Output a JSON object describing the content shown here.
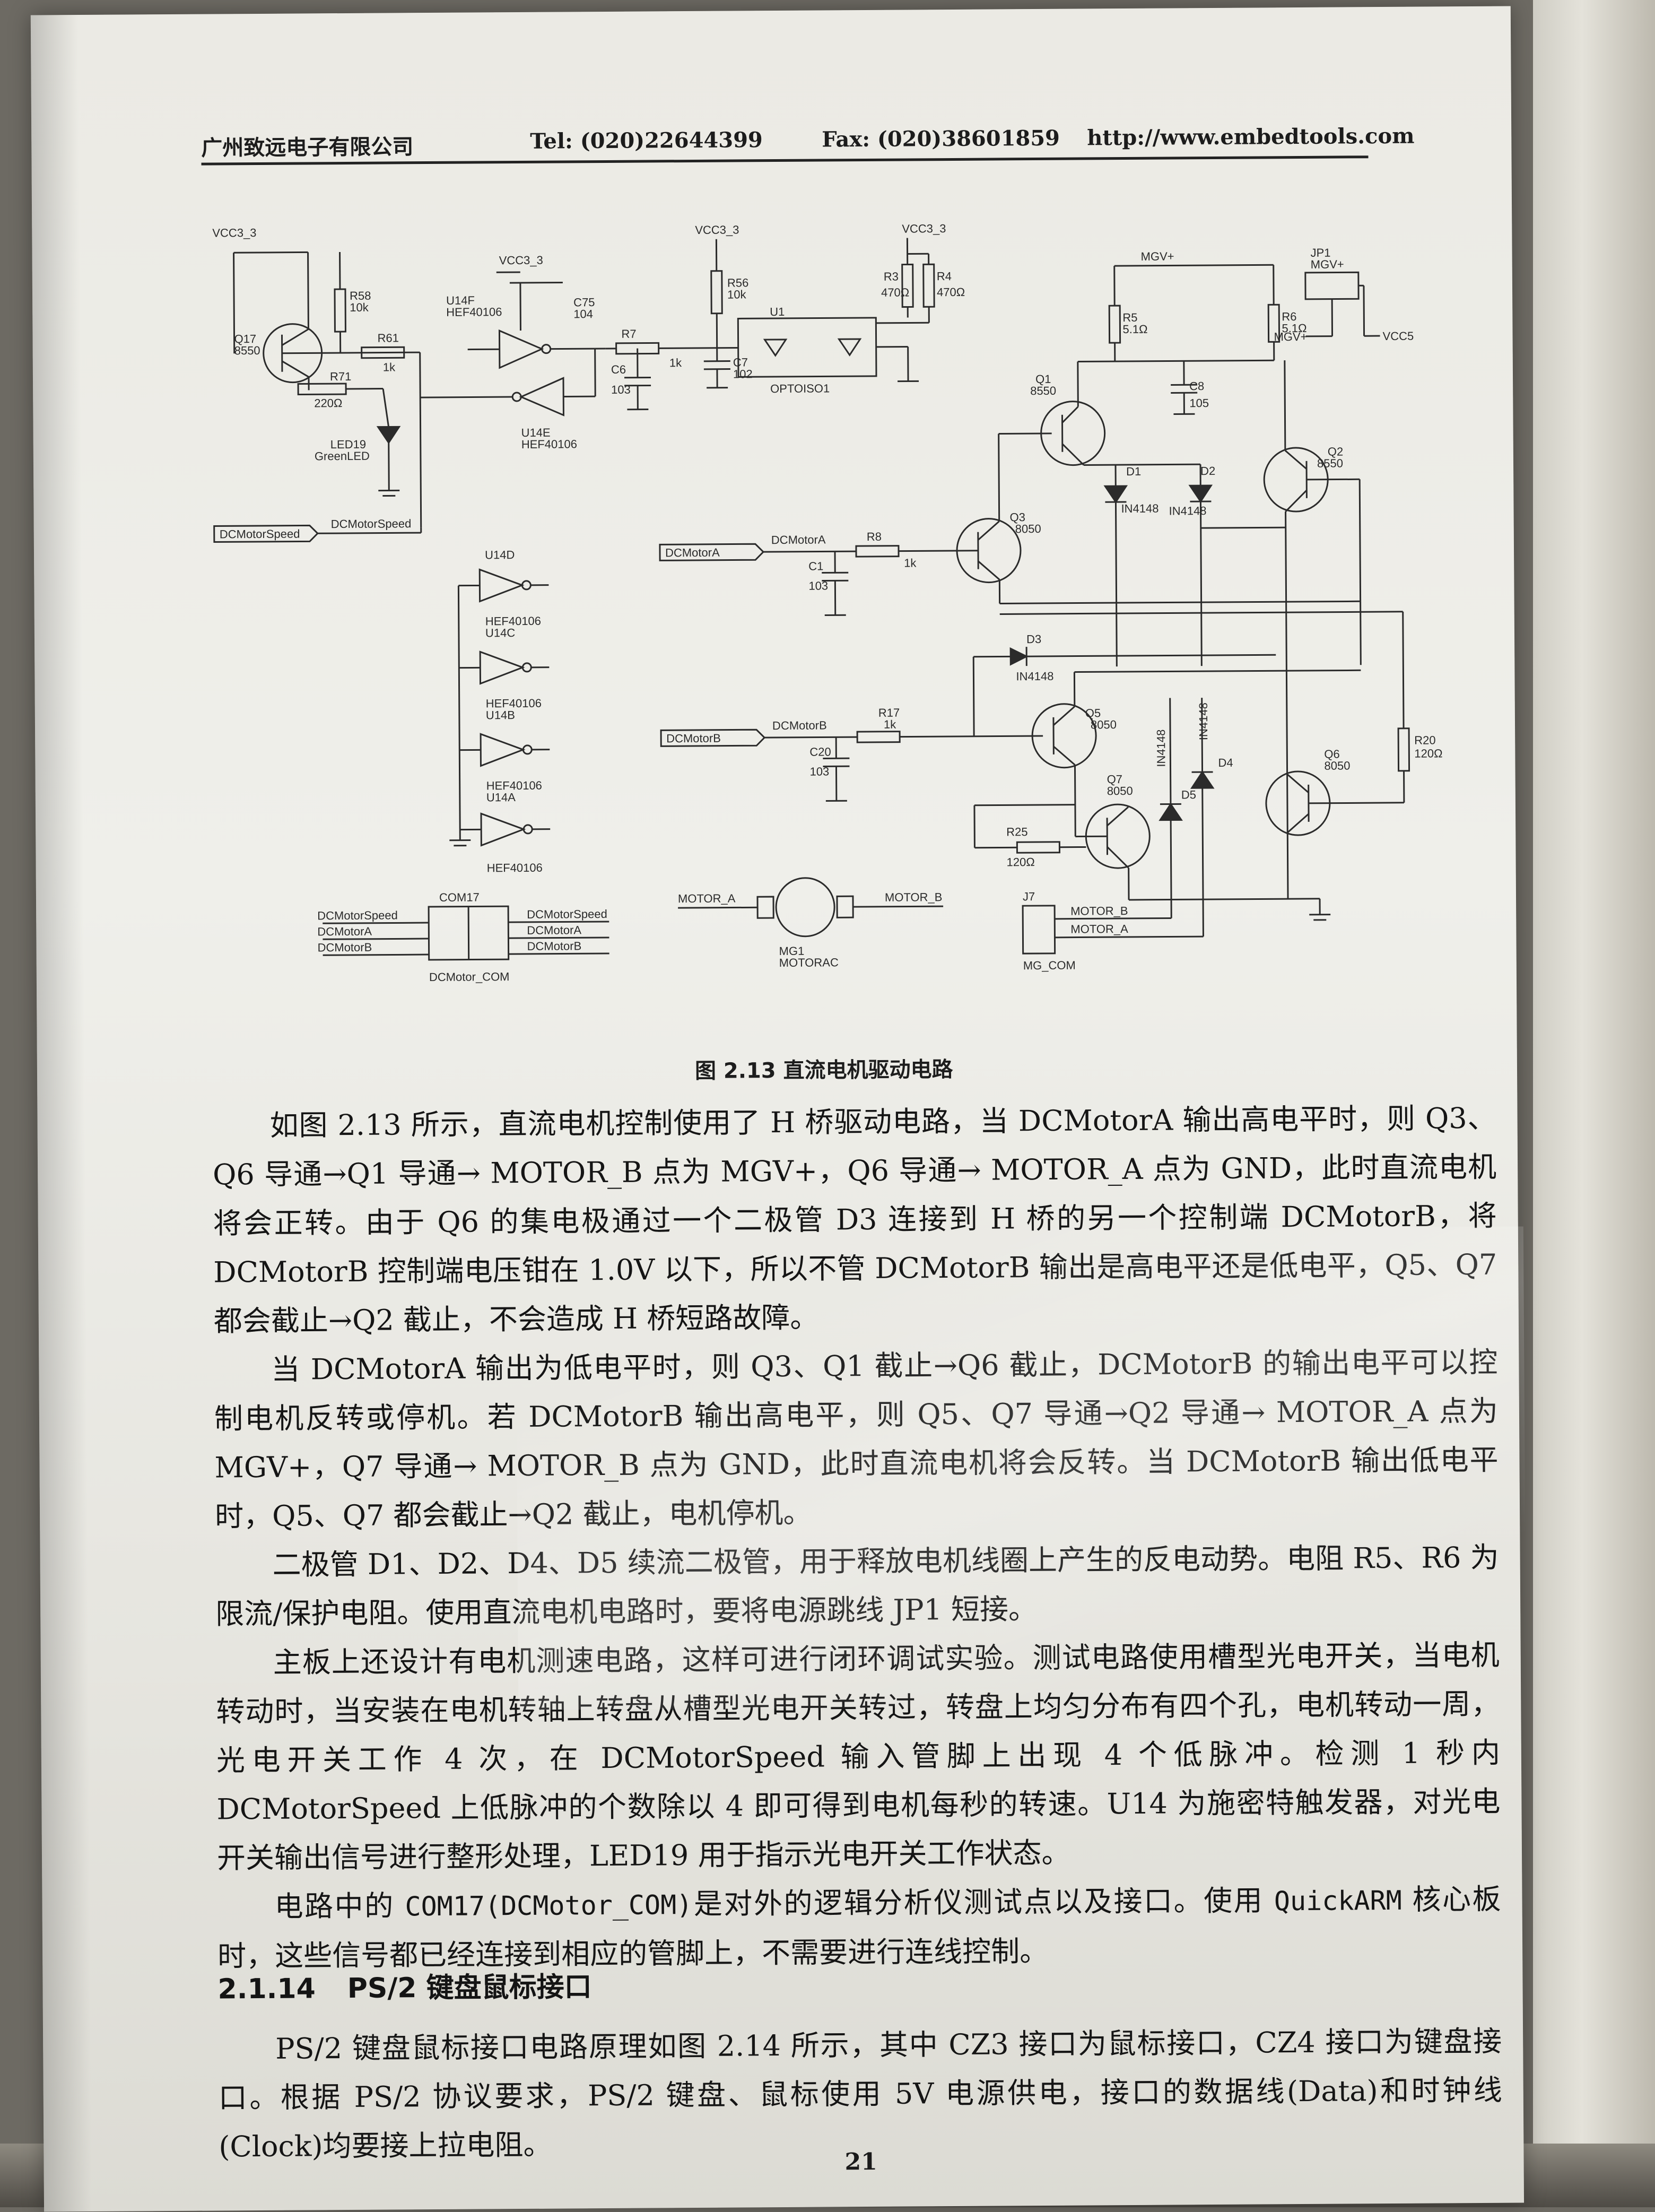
{
  "header": {
    "company": "广州致远电子有限公司",
    "tel": "Tel: (020)22644399",
    "fax": "Fax: (020)38601859",
    "url": "http://www.embedtools.com"
  },
  "schematic": {
    "labels": {
      "vcc": "VCC3_3",
      "mgv": "MGV+",
      "vcc5": "VCC5",
      "jp1": "JP1",
      "q17": "Q17",
      "q17_type": "8550",
      "r58": "R58",
      "r58_val": "10k",
      "r61": "R61",
      "r61_val": "1k",
      "r71": "R71",
      "r71_val": "220Ω",
      "led": "LED19",
      "led_name": "GreenLED",
      "u14f": "U14F",
      "hef": "HEF40106",
      "c75": "C75",
      "c75_val": "104",
      "u14e": "U14E",
      "r7": "R7",
      "r7_val": "1k",
      "c6": "C6",
      "c6_val": "103",
      "r56": "R56",
      "r56_val": "10k",
      "c7": "C7",
      "c7_val": "102",
      "u1": "U1",
      "opto": "OPTOISO1",
      "r3": "R3",
      "r3_val": "470Ω",
      "r4": "R4",
      "r4_val": "470Ω",
      "r5": "R5",
      "r5_val": "5.1Ω",
      "r6": "R6",
      "r6_val": "5.1Ω",
      "c8": "C8",
      "c8_val": "105",
      "q1": "Q1",
      "q1_type": "8550",
      "q2": "Q2",
      "q2_type": "8550",
      "d1": "D1",
      "d2": "D2",
      "in4148": "IN4148",
      "q3": "Q3",
      "q3_type": "8050",
      "r8": "R8",
      "r8_val": "1k",
      "c1": "C1",
      "c1_val": "103",
      "d3": "D3",
      "q5": "Q5",
      "q5_type": "8050",
      "r17": "R17",
      "r17_val": "1k",
      "c20": "C20",
      "c20_val": "103",
      "q7": "Q7",
      "q7_type": "8050",
      "r25": "R25",
      "r25_val": "120Ω",
      "d4": "D4",
      "d5": "D5",
      "q6": "Q6",
      "q6_type": "8050",
      "r20": "R20",
      "r20_val": "120Ω",
      "u14d": "U14D",
      "u14c": "U14C",
      "u14b": "U14B",
      "u14a": "U14A",
      "dc_speed": "DCMotorSpeed",
      "dc_a": "DCMotorA",
      "dc_b": "DCMotorB",
      "com17": "COM17",
      "dc_com": "DCMotor_COM",
      "motor_a": "MOTOR_A",
      "motor_b": "MOTOR_B",
      "mg1": "MG1",
      "motorac": "MOTORAC",
      "j7": "J7",
      "mg_com": "MG_COM"
    }
  },
  "caption": "图 2.13   直流电机驱动电路",
  "paragraphs": [
    "如图 2.13 所示，直流电机控制使用了 H 桥驱动电路，当 DCMotorA 输出高电平时，则 Q3、Q6 导通→Q1 导通→ MOTOR_B 点为 MGV+，Q6 导通→ MOTOR_A 点为 GND，此时直流电机将会正转。由于 Q6 的集电极通过一个二极管 D3 连接到 H 桥的另一个控制端 DCMotorB，将 DCMotorB 控制端电压钳在 1.0V 以下，所以不管 DCMotorB 输出是高电平还是低电平，Q5、Q7 都会截止→Q2 截止，不会造成 H 桥短路故障。",
    "当 DCMotorA 输出为低电平时，则 Q3、Q1 截止→Q6 截止，DCMotorB 的输出电平可以控制电机反转或停机。若 DCMotorB 输出高电平，则 Q5、Q7 导通→Q2 导通→ MOTOR_A 点为 MGV+，Q7 导通→ MOTOR_B 点为 GND，此时直流电机将会反转。当 DCMotorB 输出低电平时，Q5、Q7 都会截止→Q2 截止，电机停机。",
    "二极管 D1、D2、D4、D5 续流二极管，用于释放电机线圈上产生的反电动势。电阻 R5、R6 为限流/保护电阻。使用直流电机电路时，要将电源跳线 JP1 短接。",
    "主板上还设计有电机测速电路，这样可进行闭环调试实验。测试电路使用槽型光电开关，当电机转动时，当安装在电机转轴上转盘从槽型光电开关转过，转盘上均匀分布有四个孔，电机转动一周，光电开关工作 4 次，在 DCMotorSpeed 输入管脚上出现 4 个低脉冲。检测 1 秒内 DCMotorSpeed 上低脉冲的个数除以 4 即可得到电机每秒的转速。U14 为施密特触发器，对光电开关输出信号进行整形处理，LED19 用于指示光电开关工作状态。"
  ],
  "paragraph5": {
    "pre": "电路中的 ",
    "mono": "COM17(DCMotor_COM)",
    "mid": "是对外的逻辑分析仪测试点以及接口。使用 ",
    "mono2": "QuickARM",
    "post": " 核心板时，这些信号都已经连接到相应的管脚上，不需要进行连线控制。"
  },
  "section": {
    "number": "2.1.14",
    "title": "PS/2 键盘鼠标接口"
  },
  "ps2_paragraph": "PS/2 键盘鼠标接口电路原理如图 2.14 所示，其中 CZ3 接口为鼠标接口，CZ4 接口为键盘接口。根据 PS/2 协议要求，PS/2 键盘、鼠标使用 5V 电源供电，接口的数据线(Data)和时钟线(Clock)均要接上拉电阻。",
  "page_number": "21"
}
